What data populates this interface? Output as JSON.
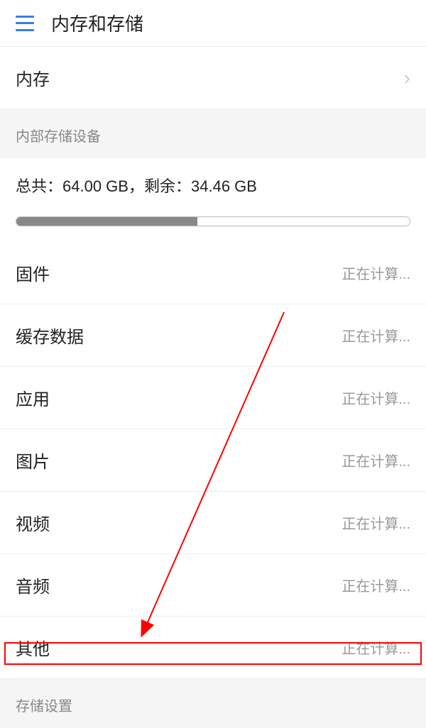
{
  "header": {
    "title": "内存和存储"
  },
  "memory": {
    "label": "内存"
  },
  "internalStorage": {
    "sectionTitle": "内部存储设备",
    "totalLabel": "总共：",
    "totalValue": "64.00 GB",
    "separator": "，",
    "remainingLabel": "剩余：",
    "remainingValue": "34.46 GB",
    "progressPercent": 46
  },
  "categories": [
    {
      "label": "固件",
      "value": "正在计算..."
    },
    {
      "label": "缓存数据",
      "value": "正在计算..."
    },
    {
      "label": "应用",
      "value": "正在计算..."
    },
    {
      "label": "图片",
      "value": "正在计算..."
    },
    {
      "label": "视频",
      "value": "正在计算..."
    },
    {
      "label": "音频",
      "value": "正在计算..."
    },
    {
      "label": "其他",
      "value": "正在计算..."
    }
  ],
  "storageSettings": {
    "sectionTitle": "存储设置"
  }
}
